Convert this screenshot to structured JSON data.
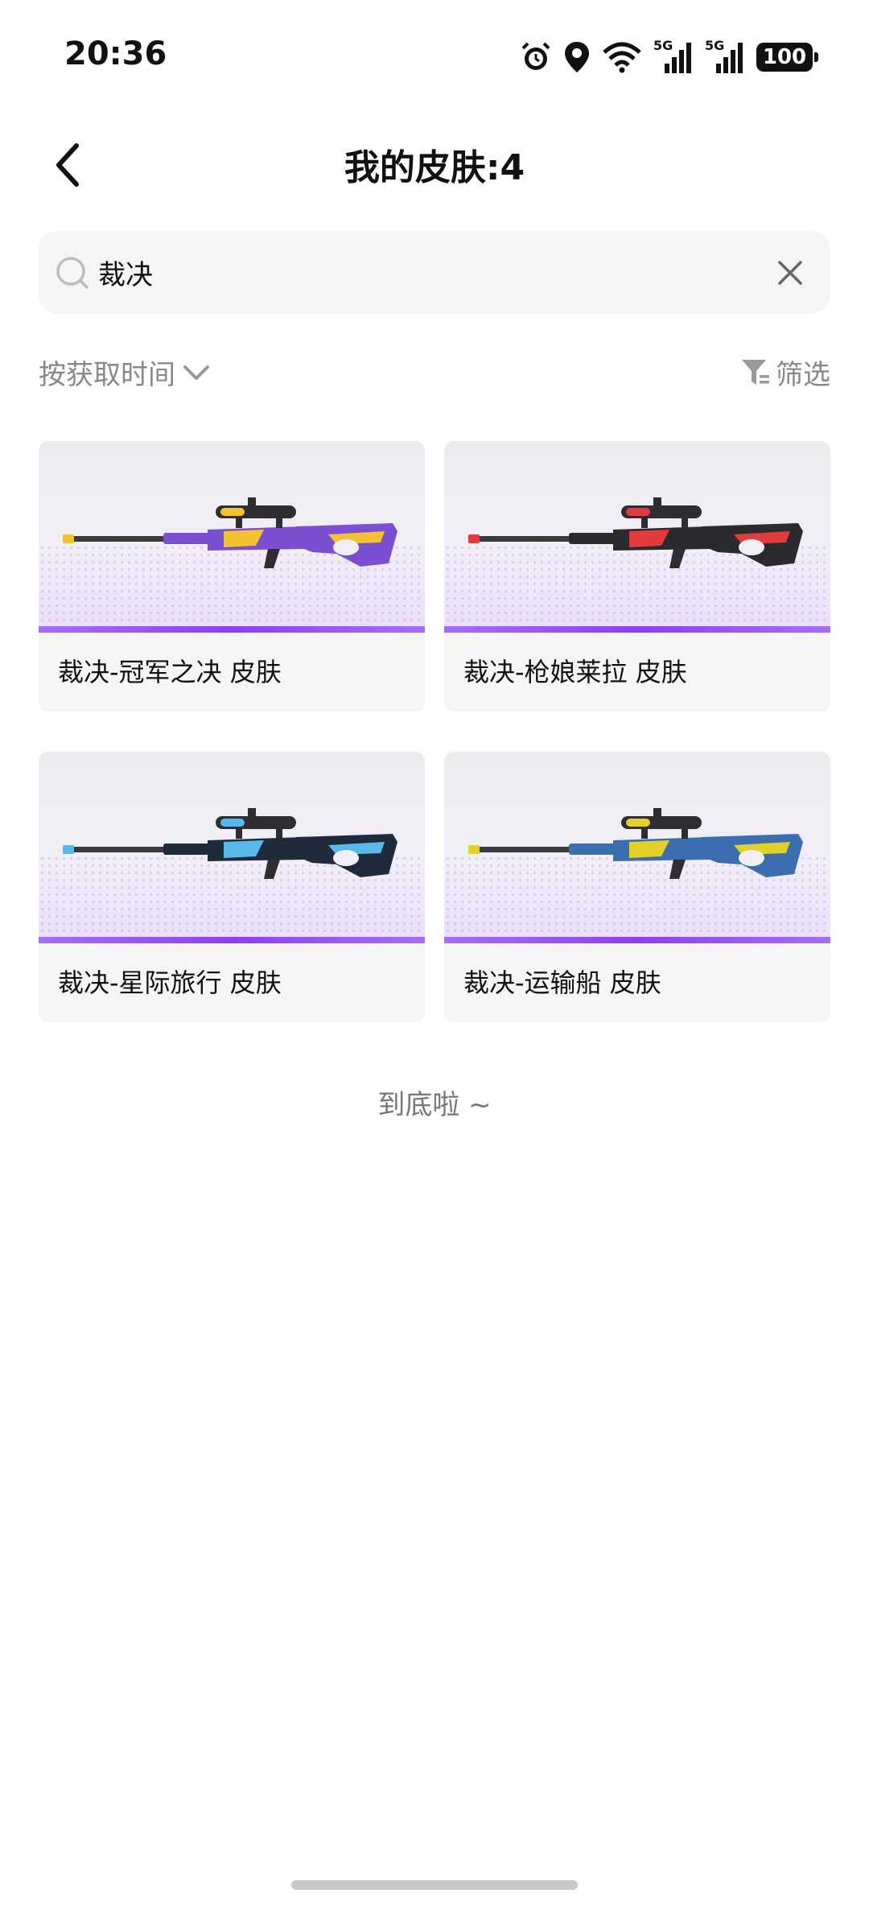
{
  "status_bar": {
    "time": "20:36",
    "signal_1_label": "5G",
    "signal_2_label": "5G",
    "battery": "100"
  },
  "header": {
    "title": "我的皮肤:4"
  },
  "search": {
    "value": "裁决"
  },
  "toolbar": {
    "sort_label": "按获取时间",
    "filter_label": "筛选"
  },
  "skins": [
    {
      "name": "裁决-冠军之决 皮肤",
      "body_color": "#7a4fd1",
      "accent_color": "#f2c230"
    },
    {
      "name": "裁决-枪娘莱拉 皮肤",
      "body_color": "#2b2b2f",
      "accent_color": "#e23b3b"
    },
    {
      "name": "裁决-星际旅行 皮肤",
      "body_color": "#1f2a3a",
      "accent_color": "#58b8e8"
    },
    {
      "name": "裁决-运输船 皮肤",
      "body_color": "#3c6db0",
      "accent_color": "#e2cf2a"
    }
  ],
  "footer": {
    "end_text": "到底啦 ~"
  },
  "colors": {
    "rarity_purple": "#8c3ff0",
    "search_bg": "#f5f5f6"
  }
}
